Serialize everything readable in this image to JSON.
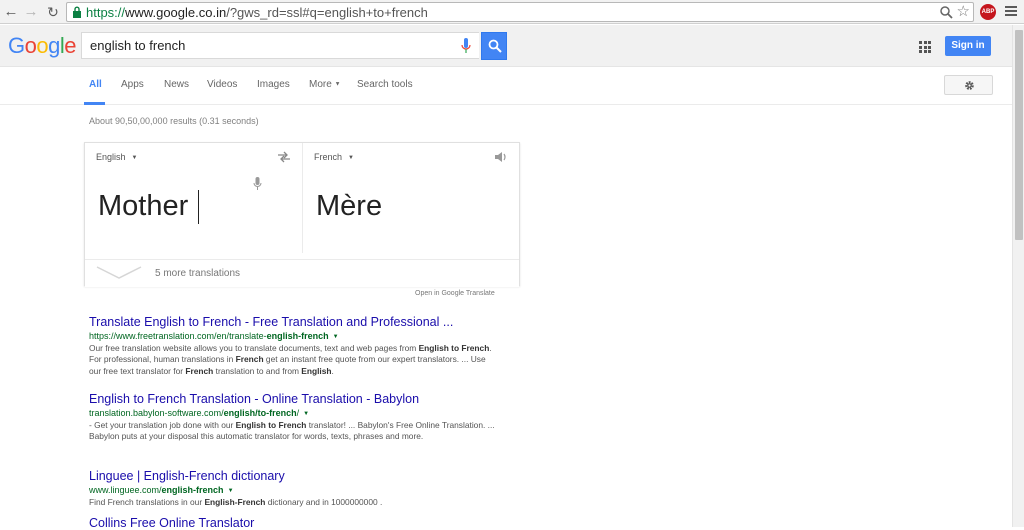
{
  "browser": {
    "url_scheme": "https://",
    "url_host": "www.google.co.in",
    "url_rest": "/?gws_rd=ssl#q=english+to+french"
  },
  "header": {
    "logo_letters": [
      "G",
      "o",
      "o",
      "g",
      "l",
      "e"
    ],
    "search_value": "english to french",
    "signin_label": "Sign in"
  },
  "tabs": {
    "all": "All",
    "apps": "Apps",
    "news": "News",
    "videos": "Videos",
    "images": "Images",
    "more": "More",
    "search_tools": "Search tools"
  },
  "result_stats": "About 90,50,00,000 results (0.31 seconds)",
  "translate": {
    "source_lang": "English",
    "target_lang": "French",
    "source_text": "Mother",
    "target_text": "Mère",
    "more_translations": "5 more translations",
    "open_link": "Open in Google Translate"
  },
  "results": [
    {
      "title": "Translate English to French - Free Translation and Professional ...",
      "url_pre": "https://www.freetranslation.com/en/translate-",
      "url_bold": "english-french",
      "url_post": "",
      "snippet_parts": [
        "Our free translation website allows you to translate documents, text and web pages from ",
        "English to French",
        ". For professional, human translations in ",
        "French",
        " get an instant free quote from our expert translators. ... Use our free text translator for ",
        "French",
        " translation to and from ",
        "English",
        "."
      ]
    },
    {
      "title": "English to French Translation - Online Translation - Babylon",
      "url_pre": "translation.babylon-software.com/",
      "url_bold": "english/to-french",
      "url_post": "/",
      "snippet_parts": [
        "- Get your translation job done with our ",
        "English to French",
        " translator! ... Babylon's Free Online Translation. ... Babylon puts at your disposal this automatic translator for words, texts, phrases and more.",
        "",
        "",
        "",
        "",
        "",
        ""
      ]
    },
    {
      "title": "Linguee | English-French dictionary",
      "url_pre": "www.linguee.com/",
      "url_bold": "english-french",
      "url_post": "",
      "snippet_parts": [
        "Find French translations in our ",
        "English-French",
        " dictionary and in 1000000000 .",
        "",
        "",
        "",
        "",
        "",
        ""
      ]
    },
    {
      "title": "Collins Free Online Translator",
      "url_pre": "",
      "url_bold": "",
      "url_post": "",
      "snippet_parts": [
        "",
        "",
        "",
        "",
        "",
        "",
        "",
        "",
        ""
      ]
    }
  ]
}
